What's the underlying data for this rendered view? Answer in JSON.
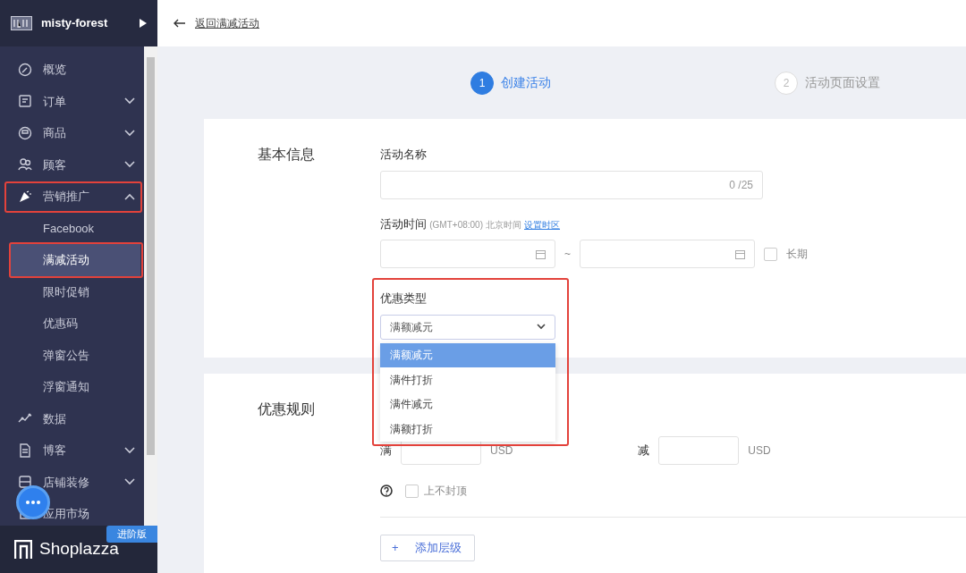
{
  "store": {
    "name": "misty-forest"
  },
  "sidebar": {
    "items": [
      {
        "label": "概览",
        "selected": false,
        "annotated": false
      },
      {
        "label": "订单",
        "selected": false,
        "annotated": false,
        "expanded": false
      },
      {
        "label": "商品",
        "selected": false,
        "annotated": false,
        "expanded": false
      },
      {
        "label": "顾客",
        "selected": false,
        "annotated": false,
        "expanded": false
      },
      {
        "label": "营销推广",
        "selected": false,
        "annotated": true,
        "expanded": true,
        "children": [
          {
            "label": "Facebook",
            "selected": false,
            "annotated": false
          },
          {
            "label": "满减活动",
            "selected": true,
            "annotated": true
          },
          {
            "label": "限时促销",
            "selected": false,
            "annotated": false
          },
          {
            "label": "优惠码",
            "selected": false,
            "annotated": false
          },
          {
            "label": "弹窗公告",
            "selected": false,
            "annotated": false
          },
          {
            "label": "浮窗通知",
            "selected": false,
            "annotated": false
          }
        ]
      },
      {
        "label": "数据",
        "selected": false,
        "annotated": false
      },
      {
        "label": "博客",
        "selected": false,
        "annotated": false,
        "expanded": false
      },
      {
        "label": "店铺装修",
        "selected": false,
        "annotated": false,
        "expanded": false
      },
      {
        "label": "应用市场",
        "selected": false,
        "annotated": false
      }
    ]
  },
  "brand": {
    "name": "Shoplazza",
    "plan_badge": "进阶版"
  },
  "back_link": "返回满减活动",
  "steps": [
    {
      "number": "1",
      "label": "创建活动",
      "selected": true
    },
    {
      "number": "2",
      "label": "活动页面设置",
      "selected": false
    }
  ],
  "basic_info": {
    "title": "基本信息",
    "name_field": {
      "label": "活动名称",
      "counter": "0 /25"
    },
    "time_field": {
      "label": "活动时间",
      "timezone": "(GMT+08:00) 北京时间",
      "timezone_link": "设置时区",
      "separator": "~",
      "long_term": {
        "label": "长期",
        "checked": false
      }
    },
    "discount_type": {
      "label": "优惠类型",
      "value": "满额减元",
      "annotated": true,
      "options": [
        {
          "label": "满额减元",
          "selected": true
        },
        {
          "label": "满件打折",
          "selected": false
        },
        {
          "label": "满件减元",
          "selected": false
        },
        {
          "label": "满额打折",
          "selected": false
        }
      ]
    }
  },
  "rules": {
    "title": "优惠规则",
    "threshold_label": "满",
    "threshold_unit": "USD",
    "reduce_label": "减",
    "reduce_unit": "USD",
    "no_cap": {
      "label": "上不封顶",
      "checked": false
    },
    "add_button": {
      "icon": "+",
      "label": "添加层级"
    }
  }
}
